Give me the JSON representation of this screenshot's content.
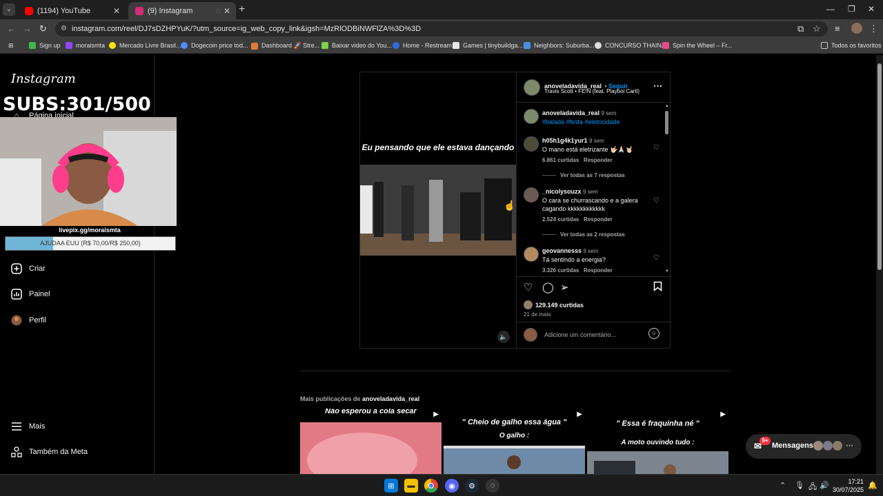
{
  "browser": {
    "tabs": [
      {
        "title": "(1194) YouTube",
        "active": false,
        "favicon_color": "#ff0000"
      },
      {
        "title": "(9) Instagram",
        "active": true,
        "favicon_color": "#d62976"
      }
    ],
    "url": "instagram.com/reel/DJ7sDZHPYuK/?utm_source=ig_web_copy_link&igsh=MzRlODBiNWFlZA%3D%3D",
    "bookmarks": [
      "Sign up",
      "moraismta",
      "Mercado Livre Brasil...",
      "Dogecoin price tod...",
      "Dashboard 🚀 Stre...",
      "Baixar video do You...",
      "Home - Restream",
      "Games | tinybuildga...",
      "Neighbors: Suburba...",
      "CONCURSO THAINÁ",
      "Spin the Wheel – Fr..."
    ],
    "bookmarks_folder": "Todos os favoritos"
  },
  "sidebar": {
    "logo": "Instagram",
    "home_partial": "Página inicial",
    "items": [
      {
        "label": "Criar",
        "icon": "plus-square-icon"
      },
      {
        "label": "Painel",
        "icon": "chart-icon"
      },
      {
        "label": "Perfil",
        "icon": "profile-avatar"
      }
    ],
    "bottom": [
      {
        "label": "Mais",
        "icon": "menu-icon"
      },
      {
        "label": "Também da Meta",
        "icon": "meta-apps-icon"
      }
    ]
  },
  "stream_overlay": {
    "subs": "SUBS:301/500",
    "livepix": "livepix.gg/moraismta",
    "goal_text": "AJUDAA EUU (R$ 70,00/R$ 250,00)",
    "goal_fraction": 0.28
  },
  "post": {
    "video_caption": "Eu pensando que ele estava dançando",
    "author": "anoveladavida_real",
    "follow": "Seguir",
    "audio": "Travis Scott • FE!N (feat. Playboi Carti)",
    "caption": {
      "user": "anoveladavida_real",
      "time": "9 sem",
      "text": "#balada #festa #eletricidade"
    },
    "comments": [
      {
        "user": "h05h1g4k1yur1",
        "time": "9 sem",
        "text": "O mano está eletrizante 🤟🏻🙏🏻🤘🏻",
        "likes": "6.861 curtidas",
        "reply": "Responder",
        "replies": "Ver todas as 7 respostas"
      },
      {
        "user": "_nicolysouzx",
        "time": "9 sem",
        "text": "O cara se churrascando e a galera cagando kkkkkkkkkkkk",
        "likes": "2.524 curtidas",
        "reply": "Responder",
        "replies": "Ver todas as 2 respostas"
      },
      {
        "user": "geovannesss",
        "time": "9 sem",
        "text": "Tá sentindo a energia?",
        "likes": "3.326 curtidas",
        "reply": "Responder"
      }
    ],
    "likes": "129.149 curtidas",
    "date": "21 de maio",
    "add_comment_placeholder": "Adicione um comentário..."
  },
  "more_posts": {
    "label_prefix": "Mais publicações de",
    "label_user": "anoveladavida_real",
    "thumbs": [
      {
        "title": "Não esperou a cola secar",
        "subtitle": ""
      },
      {
        "title": "\" Cheio de galho essa água \"",
        "subtitle": "O galho :"
      },
      {
        "title": "\" Essa é fraquinha né \"",
        "subtitle": "A moto ouvindo tudo :"
      }
    ]
  },
  "messages": {
    "label": "Mensagens",
    "badge": "9+"
  },
  "taskbar": {
    "time": "17:21",
    "date": "30/07/2025"
  }
}
